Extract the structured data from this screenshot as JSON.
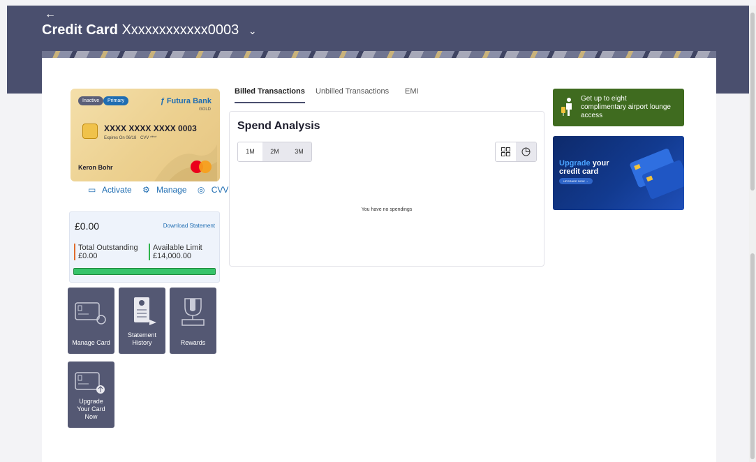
{
  "header": {
    "back_label": "←",
    "title_bold": "Credit Card",
    "title_number": "Xxxxxxxxxxxx0003",
    "title_chevron": "⌄"
  },
  "card": {
    "status_badge": "Inactive",
    "type_badge": "Primary",
    "bank_name": "Futura Bank",
    "tier": "GOLD",
    "number": "XXXX XXXX XXXX 0003",
    "expiry": "Expires On 06/18",
    "cvv_mask": "CVV ****",
    "holder": "Keron Bohr",
    "network": "mastercard",
    "actions": [
      {
        "label": "Activate",
        "icon": "card-icon"
      },
      {
        "label": "Manage",
        "icon": "gear-icon"
      },
      {
        "label": "CVV",
        "icon": "eye-icon"
      }
    ]
  },
  "summary": {
    "amount": "£0.00",
    "download_label": "Download Statement",
    "outstanding_label": "Total Outstanding",
    "outstanding_value": "£0.00",
    "limit_label": "Available Limit",
    "limit_value": "£14,000.00",
    "limit_available_fraction": 1.0,
    "colors": {
      "outstanding": "#e06b2c",
      "limit": "#2fb44c",
      "bar": "#37c46a"
    }
  },
  "tiles": [
    {
      "label": "Manage Card",
      "icon": "manage-card-icon"
    },
    {
      "label": "Statement\nHistory",
      "icon": "statement-icon"
    },
    {
      "label": "Rewards",
      "icon": "trophy-icon"
    },
    {
      "label": "Upgrade\nYour Card\nNow",
      "icon": "upgrade-card-icon"
    }
  ],
  "tabs": [
    {
      "label": "Billed Transactions",
      "active": true
    },
    {
      "label": "Unbilled Transactions",
      "active": false
    },
    {
      "label": "EMI",
      "active": false
    }
  ],
  "spend": {
    "title": "Spend Analysis",
    "ranges": [
      "1M",
      "2M",
      "3M"
    ],
    "selected_range": "1M",
    "views": [
      "grid-view-icon",
      "pie-chart-icon"
    ],
    "empty_message": "You have no spendings"
  },
  "promos": {
    "lounge_text": "Get up to eight complimentary airport lounge access",
    "lounge_icon": "traveler-icon",
    "upgrade_highlight": "Upgrade",
    "upgrade_rest": "your",
    "upgrade_line2": "credit card",
    "upgrade_cta": "UPGRADE NOW →"
  },
  "colors": {
    "header_bg": "#4a4f6e",
    "accent": "#1f6db2",
    "tile_bg": "#545873",
    "promo_green": "#3f6b1f",
    "promo_blue": "#123a8f"
  }
}
